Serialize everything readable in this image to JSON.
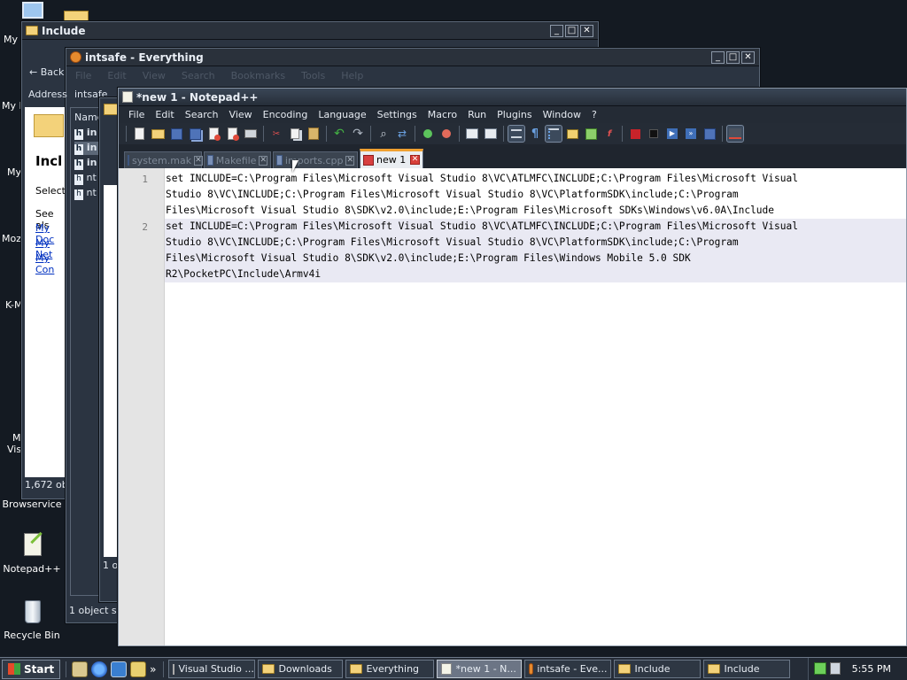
{
  "desktop": {
    "icons": [
      {
        "label": "Browservice"
      },
      {
        "label": "Notepad++"
      },
      {
        "label": "Recycle Bin"
      }
    ],
    "edge_labels": [
      "My",
      "My D",
      "My",
      "Moz",
      "K-M",
      "M",
      "Vis"
    ]
  },
  "windows": {
    "include_back": {
      "title": "Include",
      "status": "1,672 ob",
      "pane_heading": "Incl",
      "pane_text": "Select",
      "links_header": "See als",
      "links": [
        "My Doc",
        "My Net",
        "My Con"
      ]
    },
    "intsafe": {
      "title": "intsafe - Everything",
      "menu": [
        "File",
        "Edit",
        "View",
        "Search",
        "Bookmarks",
        "Tools",
        "Help"
      ],
      "address_label": "Address",
      "address_value": "intsafe",
      "back_label": "Back",
      "column_name": "Name",
      "rows": [
        "in",
        "in",
        "in",
        "nt",
        "nt"
      ],
      "status": "1 object se"
    },
    "include_front": {
      "status": "1 o"
    }
  },
  "notepad": {
    "title": "*new  1 - Notepad++",
    "menu": [
      "File",
      "Edit",
      "Search",
      "View",
      "Encoding",
      "Language",
      "Settings",
      "Macro",
      "Run",
      "Plugins",
      "Window",
      "?"
    ],
    "toolbar_icons": [
      "new-file-icon",
      "open-file-icon",
      "save-icon",
      "save-all-icon",
      "close-icon",
      "close-all-icon",
      "print-icon",
      "cut-icon",
      "copy-icon",
      "paste-icon",
      "undo-icon",
      "redo-icon",
      "find-icon",
      "replace-icon",
      "zoom-in-icon",
      "zoom-out-icon",
      "sync-v-icon",
      "sync-h-icon",
      "wrap-icon",
      "show-all-chars-icon",
      "indent-guide-icon",
      "udl-icon",
      "doc-map-icon",
      "function-list-icon",
      "record-macro-icon",
      "stop-macro-icon",
      "play-macro-icon",
      "run-macro-multiple-icon",
      "save-macro-icon",
      "spellcheck-icon"
    ],
    "tabs": [
      {
        "label": "system.mak",
        "active": false
      },
      {
        "label": "Makefile",
        "active": false
      },
      {
        "label": "imports.cpp",
        "active": false
      },
      {
        "label": "new  1",
        "active": true
      }
    ],
    "line_numbers": [
      "1",
      "2"
    ],
    "lines": [
      {
        "rows": [
          "set INCLUDE=C:\\Program Files\\Microsoft Visual Studio 8\\VC\\ATLMFC\\INCLUDE;C:\\Program Files\\Microsoft Visual",
          "Studio 8\\VC\\INCLUDE;C:\\Program Files\\Microsoft Visual Studio 8\\VC\\PlatformSDK\\include;C:\\Program",
          "Files\\Microsoft Visual Studio 8\\SDK\\v2.0\\include;E:\\Program Files\\Microsoft SDKs\\Windows\\v6.0A\\Include"
        ]
      },
      {
        "rows": [
          "set INCLUDE=C:\\Program Files\\Microsoft Visual Studio 8\\VC\\ATLMFC\\INCLUDE;C:\\Program Files\\Microsoft Visual",
          "Studio 8\\VC\\INCLUDE;C:\\Program Files\\Microsoft Visual Studio 8\\VC\\PlatformSDK\\include;C:\\Program",
          "Files\\Microsoft Visual Studio 8\\SDK\\v2.0\\include;E:\\Program Files\\Windows Mobile 5.0 SDK",
          "R2\\PocketPC\\Include\\Armv4i"
        ]
      }
    ]
  },
  "taskbar": {
    "start_label": "Start",
    "tasks": [
      {
        "label": "Visual Studio ...",
        "icon": "console-icon",
        "active": false
      },
      {
        "label": "Downloads",
        "icon": "folder-icon",
        "active": false
      },
      {
        "label": "Everything",
        "icon": "folder-icon",
        "active": false
      },
      {
        "label": "*new  1 - N...",
        "icon": "notepad-icon",
        "active": true
      },
      {
        "label": "intsafe - Eve...",
        "icon": "everything-icon",
        "active": false
      },
      {
        "label": "Include",
        "icon": "folder-icon",
        "active": false
      },
      {
        "label": "Include",
        "icon": "folder-icon",
        "active": false
      }
    ],
    "clock": "5:55 PM"
  }
}
